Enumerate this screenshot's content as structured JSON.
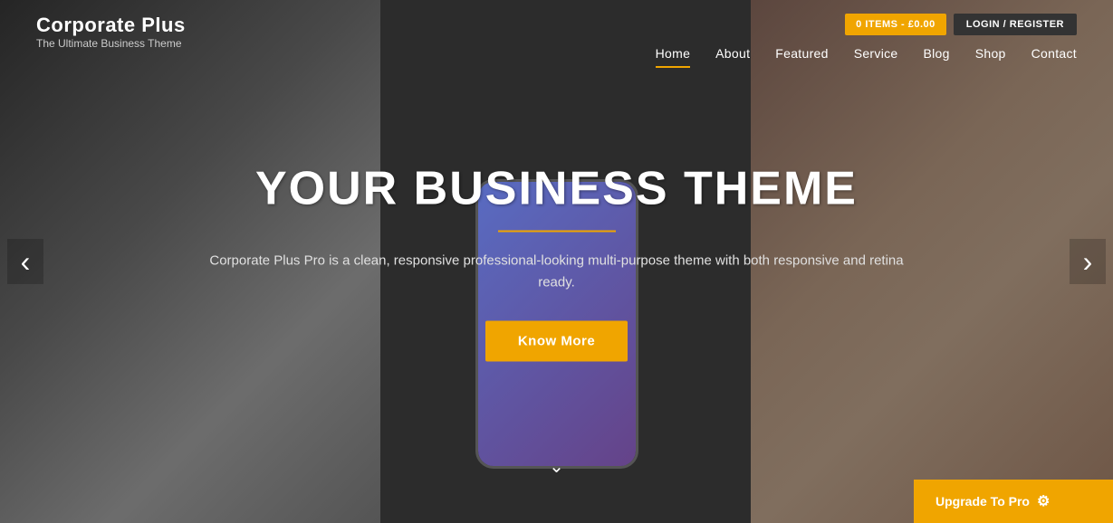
{
  "logo": {
    "title": "Corporate Plus",
    "subtitle": "The Ultimate Business Theme"
  },
  "topbar": {
    "cart_label": "0 ITEMS - £0.00",
    "login_label": "LOGIN / REGISTER"
  },
  "nav": {
    "items": [
      {
        "label": "Home",
        "active": true
      },
      {
        "label": "About",
        "active": false
      },
      {
        "label": "Featured",
        "active": false
      },
      {
        "label": "Service",
        "active": false
      },
      {
        "label": "Blog",
        "active": false
      },
      {
        "label": "Shop",
        "active": false
      },
      {
        "label": "Contact",
        "active": false
      }
    ]
  },
  "hero": {
    "title": "YOUR BUSINESS THEME",
    "description": "Corporate Plus Pro is a clean, responsive professional-looking multi-purpose theme with both responsive and retina ready.",
    "cta_label": "Know More"
  },
  "upgrade": {
    "label": "Upgrade To Pro"
  },
  "arrows": {
    "prev": "‹",
    "next": "›",
    "scroll_down": "∨"
  }
}
